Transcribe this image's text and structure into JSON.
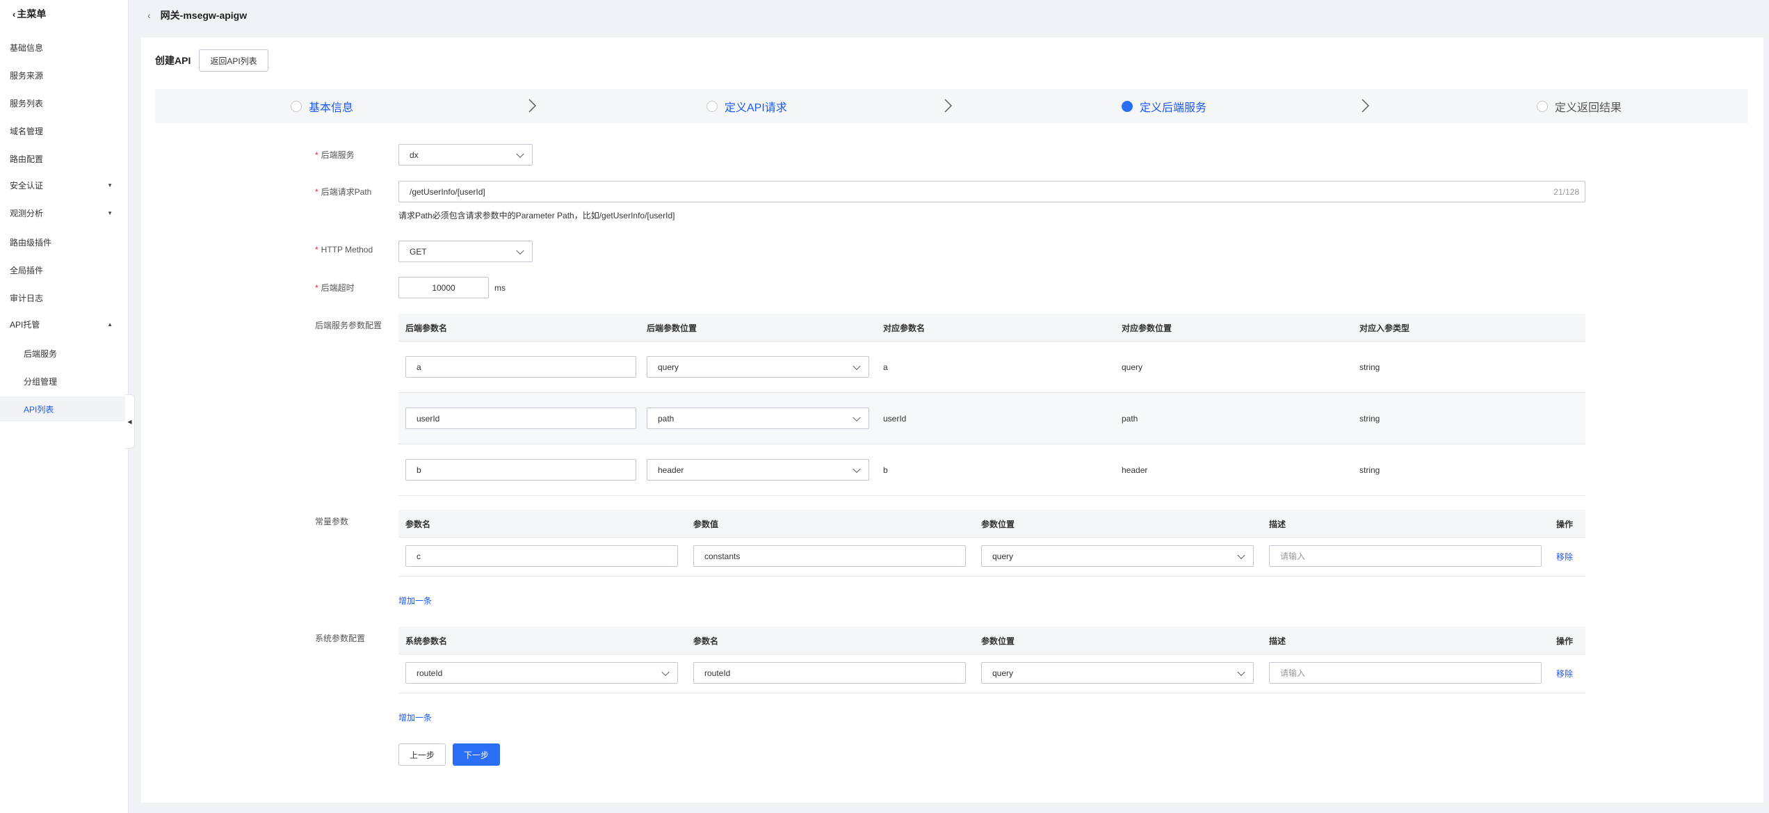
{
  "sidebar": {
    "header": "主菜单",
    "items": [
      {
        "label": "基础信息"
      },
      {
        "label": "服务来源"
      },
      {
        "label": "服务列表"
      },
      {
        "label": "域名管理"
      },
      {
        "label": "路由配置"
      },
      {
        "label": "安全认证"
      },
      {
        "label": "观测分析"
      },
      {
        "label": "路由级插件"
      },
      {
        "label": "全局插件"
      },
      {
        "label": "审计日志"
      },
      {
        "label": "API托管"
      },
      {
        "label": "后端服务"
      },
      {
        "label": "分组管理"
      },
      {
        "label": "API列表"
      }
    ]
  },
  "topbar": {
    "title": "网关-msegw-apigw"
  },
  "header": {
    "title": "创建API",
    "back_button": "返回API列表"
  },
  "steps": [
    {
      "label": "基本信息",
      "state": "pending"
    },
    {
      "label": "定义API请求",
      "state": "pending"
    },
    {
      "label": "定义后端服务",
      "state": "current"
    },
    {
      "label": "定义返回结果",
      "state": "inactive"
    }
  ],
  "form": {
    "backend_service": {
      "label": "后端服务",
      "value": "dx"
    },
    "backend_path": {
      "label": "后端请求Path",
      "value": "/getUserInfo/[userId]",
      "count": "21/128",
      "hint": "请求Path必须包含请求参数中的Parameter Path，比如/getUserInfo/[userId]"
    },
    "http_method": {
      "label": "HTTP Method",
      "value": "GET"
    },
    "timeout": {
      "label": "后端超时",
      "value": "10000",
      "unit": "ms"
    }
  },
  "backend_params": {
    "label": "后端服务参数配置",
    "columns": [
      "后端参数名",
      "后端参数位置",
      "对应参数名",
      "对应参数位置",
      "对应入参类型"
    ],
    "rows": [
      {
        "name": "a",
        "position": "query",
        "mapped_name": "a",
        "mapped_position": "query",
        "type": "string"
      },
      {
        "name": "userId",
        "position": "path",
        "mapped_name": "userId",
        "mapped_position": "path",
        "type": "string"
      },
      {
        "name": "b",
        "position": "header",
        "mapped_name": "b",
        "mapped_position": "header",
        "type": "string"
      }
    ]
  },
  "constant_params": {
    "label": "常量参数",
    "columns": [
      "参数名",
      "参数值",
      "参数位置",
      "描述",
      "操作"
    ],
    "rows": [
      {
        "name": "c",
        "value": "constants",
        "position": "query",
        "desc_placeholder": "请输入",
        "action": "移除"
      }
    ],
    "add_label": "增加一条"
  },
  "system_params": {
    "label": "系统参数配置",
    "columns": [
      "系统参数名",
      "参数名",
      "参数位置",
      "描述",
      "操作"
    ],
    "rows": [
      {
        "system_name": "routeId",
        "name": "routeId",
        "position": "query",
        "desc_placeholder": "请输入",
        "action": "移除"
      }
    ],
    "add_label": "增加一条"
  },
  "footer": {
    "prev": "上一步",
    "next": "下一步"
  },
  "colors": {
    "primary": "#2a6ef5",
    "link": "#1b58f4",
    "required": "#e72b2b"
  }
}
